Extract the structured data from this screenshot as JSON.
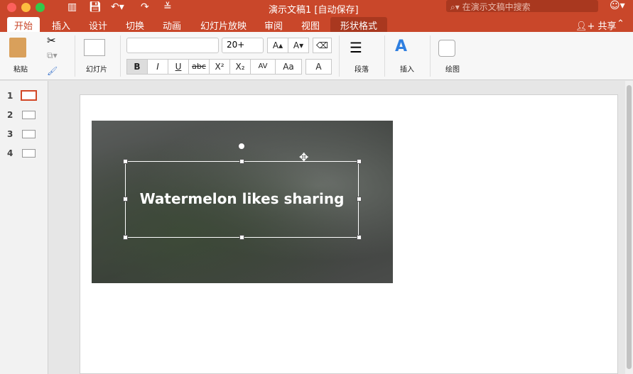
{
  "window": {
    "title": "演示文稿1 [自动保存]",
    "search_placeholder": "在演示文稿中搜索"
  },
  "tabs": [
    "开始",
    "插入",
    "设计",
    "切换",
    "动画",
    "幻灯片放映",
    "审阅",
    "视图",
    "形状格式"
  ],
  "share": "共享",
  "ribbon": {
    "paste": "粘贴",
    "slides": "幻灯片",
    "font_name": "",
    "font_size": "20+",
    "bold": "B",
    "italic": "I",
    "underline": "U",
    "strike": "abc",
    "superscript": "X²",
    "subscript": "X₂",
    "spacing": "AV",
    "case": "Aa",
    "paragraph": "段落",
    "insert": "插入",
    "draw": "绘图",
    "grow": "A▴",
    "shrink": "A▾",
    "font_color": "A"
  },
  "slides": [
    "1",
    "2",
    "3",
    "4"
  ],
  "slide": {
    "caption": "Watermelon likes sharing"
  },
  "colors": {
    "accent": "#c9472a"
  }
}
